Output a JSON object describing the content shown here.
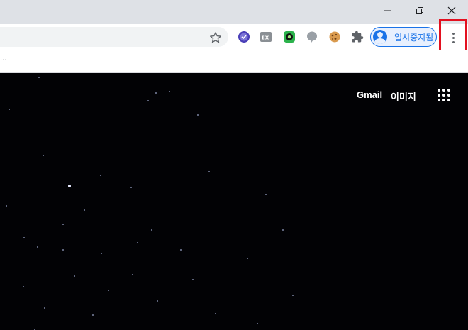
{
  "window": {
    "controls": [
      "minimize",
      "restore",
      "close"
    ]
  },
  "toolbar": {
    "profile_label": "일시중지됨",
    "extensions": [
      "check-circle-icon",
      "ex-icon",
      "green-circle-icon",
      "speech-bubble-icon",
      "cookie-icon",
      "puzzle-icon"
    ]
  },
  "bookmarks": {
    "overflow": "..."
  },
  "page": {
    "links": {
      "gmail": "Gmail",
      "images": "이미지"
    }
  },
  "colors": {
    "highlight": "#e3101f",
    "profile_accent": "#1a73e8",
    "page_background": "#020205"
  }
}
